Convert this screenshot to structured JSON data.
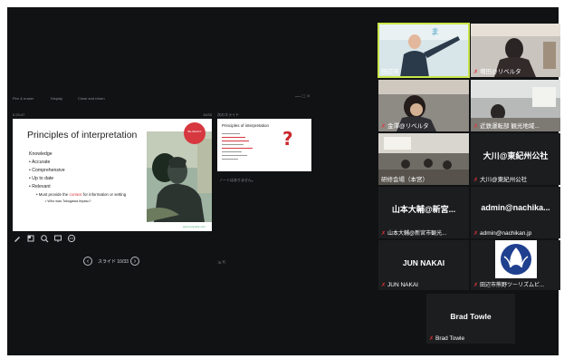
{
  "toolbar": {
    "items": [
      "Pen & eraser",
      "Display",
      "Close and return"
    ],
    "window_controls": "—  □  ×"
  },
  "presenter": {
    "timer": "0:23:47",
    "slide_counter_top": "10/33"
  },
  "slide": {
    "title": "Principles of interpretation",
    "bullets": [
      "Knowledge",
      "• Accurate",
      "• Comprehensive",
      "• Up to date",
      "• Relevant"
    ],
    "sub_bullet_pre": "•  Must provide the ",
    "sub_bullet_highlight": "context",
    "sub_bullet_post": " for information or setting",
    "sub_sub_bullet": "•  Who was Tokugawa Ieyasu?",
    "badge_text": "BE READY",
    "footer": "www.example.com"
  },
  "notes_panel": {
    "header": "次のスライド",
    "next_slide_title": "Principles of interpretation",
    "notes_placeholder": "ノートはありません。"
  },
  "pager": {
    "prev": "‹",
    "page_text": "スライド 10/33",
    "next": "›"
  },
  "participants": [
    {
      "name": "田辺市",
      "type": "video",
      "muted": false,
      "active": true
    },
    {
      "name": "増田@リベルタ",
      "type": "video",
      "muted": true
    },
    {
      "name": "金澤@リベルタ",
      "type": "video",
      "muted": true
    },
    {
      "name": "近鉄運転部 観光地域...",
      "type": "video",
      "muted": true
    },
    {
      "name": "研修会場（本宮）",
      "type": "video",
      "muted": false
    },
    {
      "name": "大川@東紀州公社",
      "display": "大川@東紀州公社",
      "type": "text",
      "muted": true
    },
    {
      "name": "山本大輔@新宮市観光...",
      "display": "山本大輔@新宮...",
      "type": "text",
      "muted": true
    },
    {
      "name": "admin@nachikan.jp",
      "display": "admin@nachika...",
      "type": "text",
      "muted": true
    },
    {
      "name": "JUN NAKAI",
      "display": "JUN NAKAI",
      "type": "text",
      "muted": true
    },
    {
      "name": "田辺市熊野ツーリズムビ...",
      "type": "logo",
      "muted": true
    },
    {
      "name": "Brad Towle",
      "display": "Brad Towle",
      "type": "text",
      "muted": true
    }
  ],
  "colors": {
    "background": "#111214",
    "tile": "#1c1d1f",
    "active_border": "#c8e64a",
    "mute_red": "#e8333a",
    "accent_red": "#d7373f"
  },
  "icons": [
    "pen-icon",
    "pointer-icon",
    "zoom-icon",
    "screen-icon",
    "more-icon",
    "mic-muted-icon"
  ]
}
